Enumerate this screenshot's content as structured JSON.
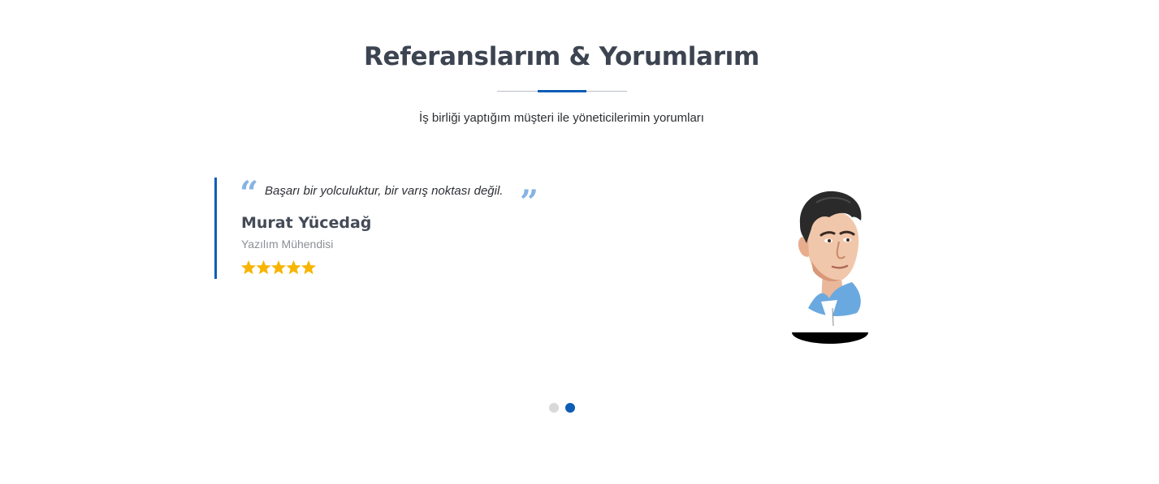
{
  "header": {
    "title": "Referanslarım & Yorumlarım",
    "subtitle": "İş birliği yaptığım müşteri ile yöneticilerimin yorumları"
  },
  "testimonial": {
    "quote_open": "“",
    "quote_close": "”",
    "quote": "Başarı bir yolculuktur, bir varış noktası değil.",
    "author_name": "Murat Yücedağ",
    "author_role": "Yazılım Mühendisi",
    "rating": 5,
    "rating_max": 5,
    "star_color": "#f7b500",
    "accent_color": "#0d5db5"
  },
  "carousel": {
    "slide_count": 2,
    "active_index": 2
  }
}
